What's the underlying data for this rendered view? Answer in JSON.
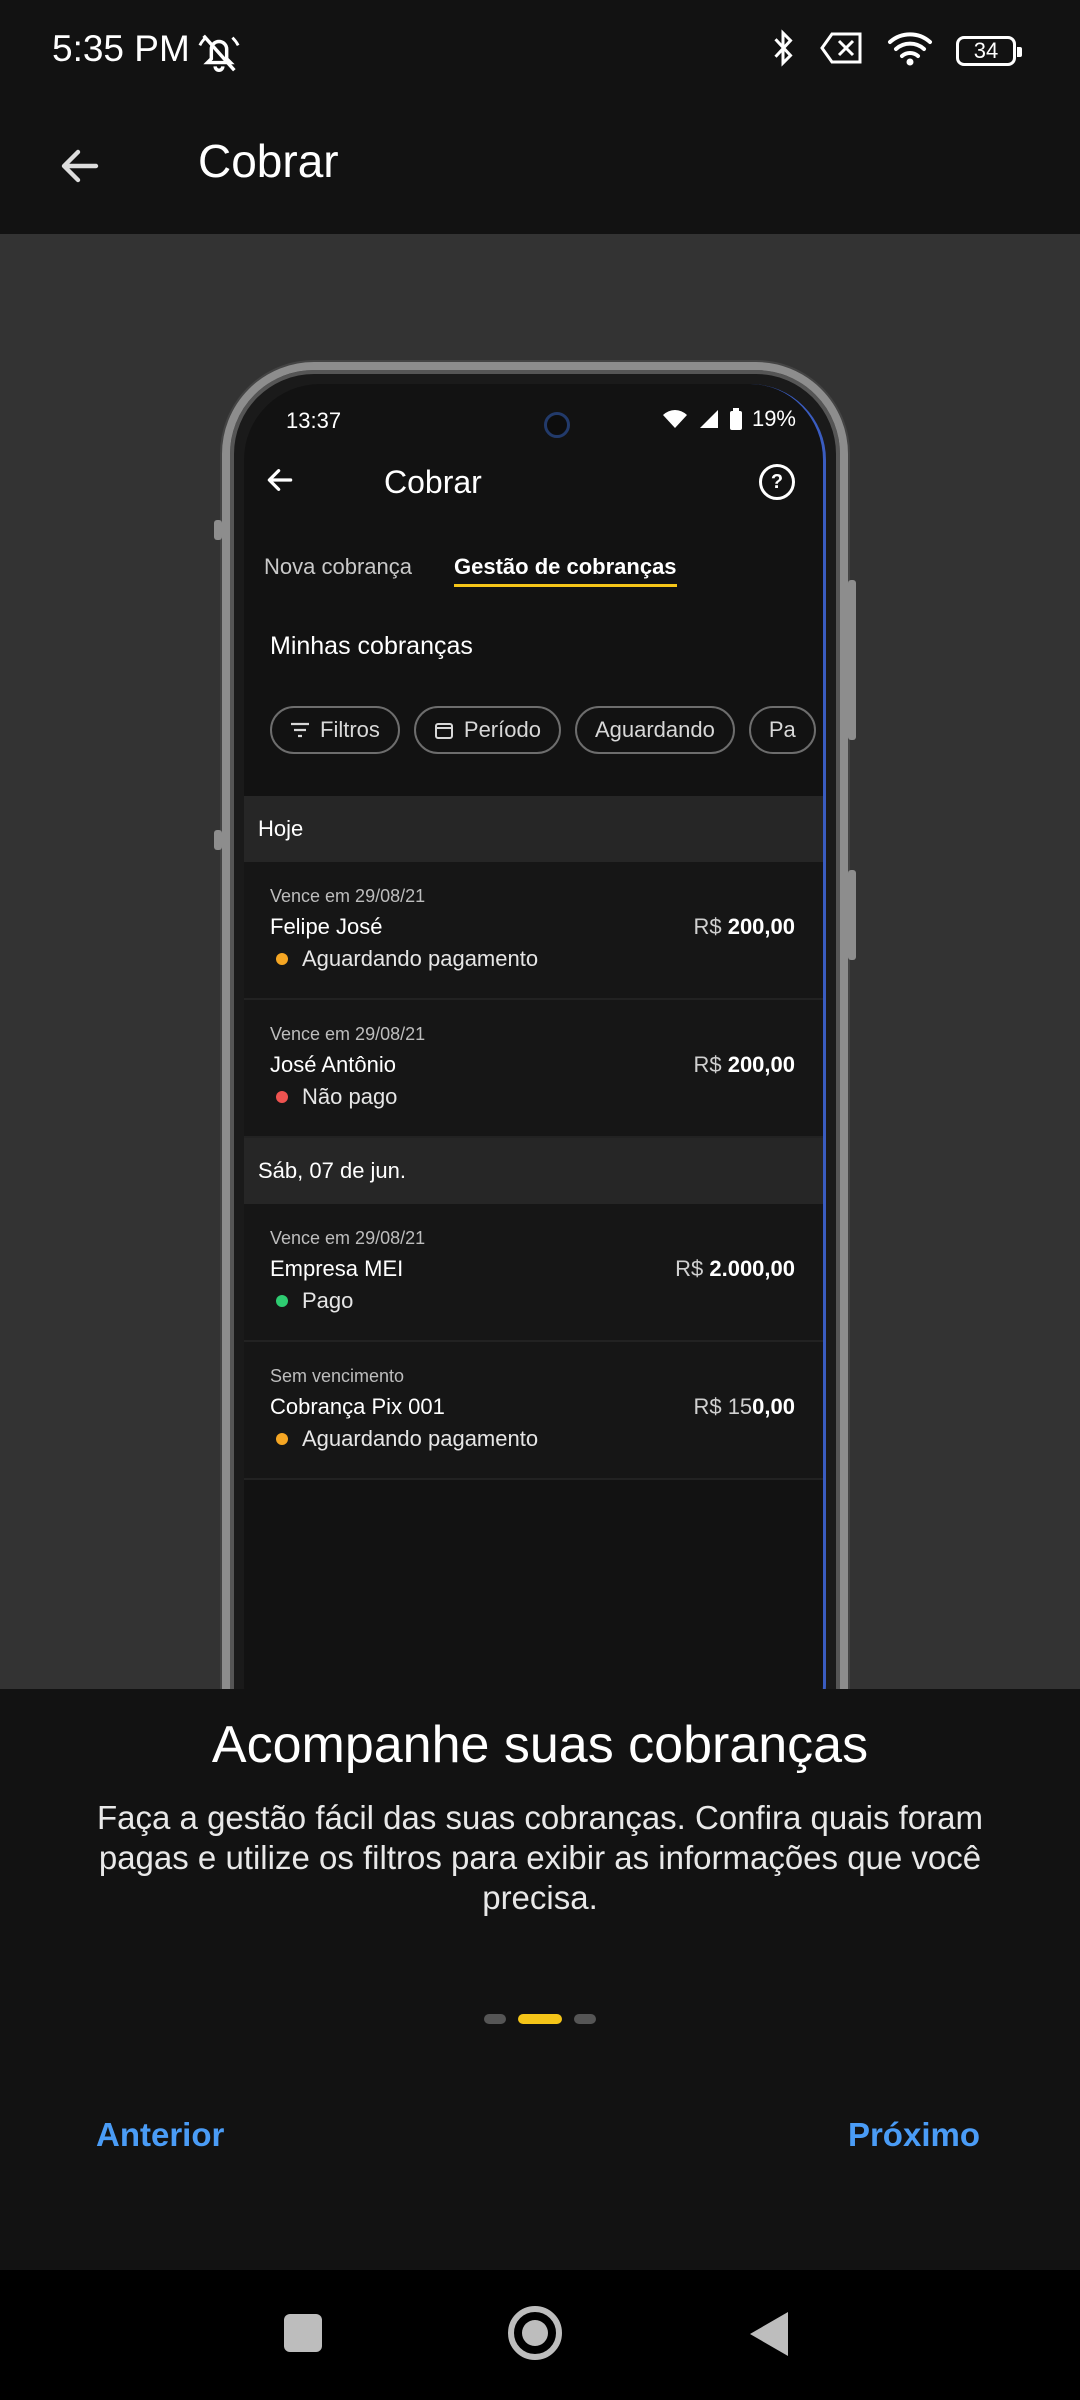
{
  "status_bar": {
    "time": "5:35 PM",
    "battery": "34",
    "icons": [
      "mute-bell-icon",
      "bluetooth-icon",
      "no-sim-icon",
      "wifi-icon",
      "battery-icon"
    ]
  },
  "appbar": {
    "title": "Cobrar",
    "back_icon": "arrow-left-icon"
  },
  "preview": {
    "status_time": "13:37",
    "battery_pct": "19%",
    "title": "Cobrar",
    "tabs": [
      "Nova cobrança",
      "Gestão de cobranças"
    ],
    "active_tab": 1,
    "section_title": "Minhas cobranças",
    "chips": [
      "Filtros",
      "Período",
      "Aguardando",
      "Pa"
    ],
    "groups": [
      {
        "header": "Hoje",
        "items": [
          {
            "due": "Vence em 29/08/21",
            "name": "Felipe José",
            "currency": "R$",
            "amount": "200,00",
            "status": "Aguardando pagamento",
            "status_color": "#f5a623"
          },
          {
            "due": "Vence em 29/08/21",
            "name": "José Antônio",
            "currency": "R$",
            "amount": "200,00",
            "status": "Não pago",
            "status_color": "#ef5350"
          }
        ]
      },
      {
        "header": "Sáb, 07 de jun.",
        "items": [
          {
            "due": "Vence em 29/08/21",
            "name": "Empresa MEI",
            "currency": "R$",
            "amount": "2.000,00",
            "status": "Pago",
            "status_color": "#2ecc71"
          },
          {
            "due": "Sem vencimento",
            "name": "Cobrança Pix 001",
            "currency": "R$ 15",
            "amount": "0,00",
            "status": "Aguardando pagamento",
            "status_color": "#f5a623"
          }
        ]
      }
    ]
  },
  "onboarding": {
    "headline": "Acompanhe suas cobranças",
    "description": "Faça a gestão fácil das suas cobranças. Confira quais foram pagas e utilize os filtros para exibir as informações que você precisa.",
    "page_count": 3,
    "current_page": 1,
    "prev_label": "Anterior",
    "next_label": "Próximo"
  },
  "colors": {
    "accent_yellow": "#f5c518",
    "link_blue": "#4a9cf6",
    "background": "#121212"
  }
}
